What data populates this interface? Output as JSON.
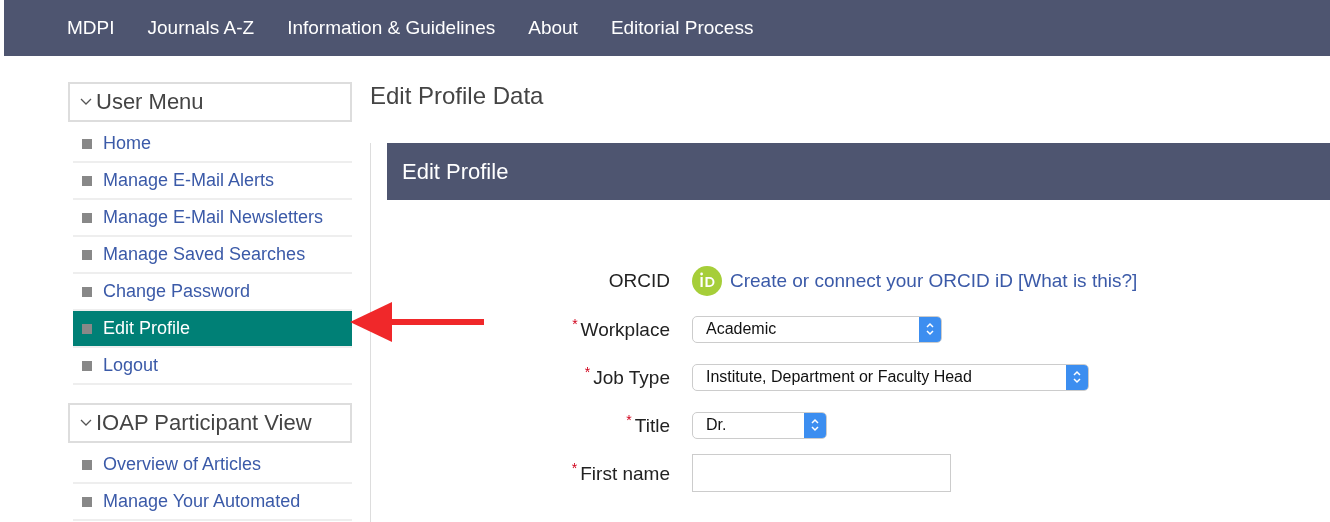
{
  "nav": [
    "MDPI",
    "Journals A-Z",
    "Information & Guidelines",
    "About",
    "Editorial Process"
  ],
  "sidebar": [
    {
      "title": "User Menu",
      "expanded": true,
      "items": [
        {
          "label": "Home",
          "selected": false
        },
        {
          "label": "Manage E-Mail Alerts",
          "selected": false
        },
        {
          "label": "Manage E-Mail Newsletters",
          "selected": false
        },
        {
          "label": "Manage Saved Searches",
          "selected": false
        },
        {
          "label": "Change Password",
          "selected": false
        },
        {
          "label": "Edit Profile",
          "selected": true
        },
        {
          "label": "Logout",
          "selected": false
        }
      ]
    },
    {
      "title": "IOAP Participant View",
      "expanded": true,
      "items": [
        {
          "label": "Overview of Articles",
          "selected": false
        },
        {
          "label": "Manage Your Automated",
          "selected": false
        }
      ]
    }
  ],
  "page_title": "Edit Profile Data",
  "panel": {
    "title": "Edit Profile",
    "fields": [
      {
        "kind": "orcid",
        "label": "ORCID",
        "link": "Create or connect your ORCID iD",
        "help": "[What is this?]"
      },
      {
        "kind": "select",
        "required_mark": "*",
        "label": "Workplace",
        "value": "Academic"
      },
      {
        "kind": "select",
        "required_mark": "*",
        "label": "Job Type",
        "value": "Institute, Department or Faculty Head"
      },
      {
        "kind": "select",
        "required_mark": "*",
        "label": "Title",
        "value": "Dr."
      },
      {
        "kind": "text",
        "required_mark": "*",
        "label": "First name"
      }
    ]
  }
}
